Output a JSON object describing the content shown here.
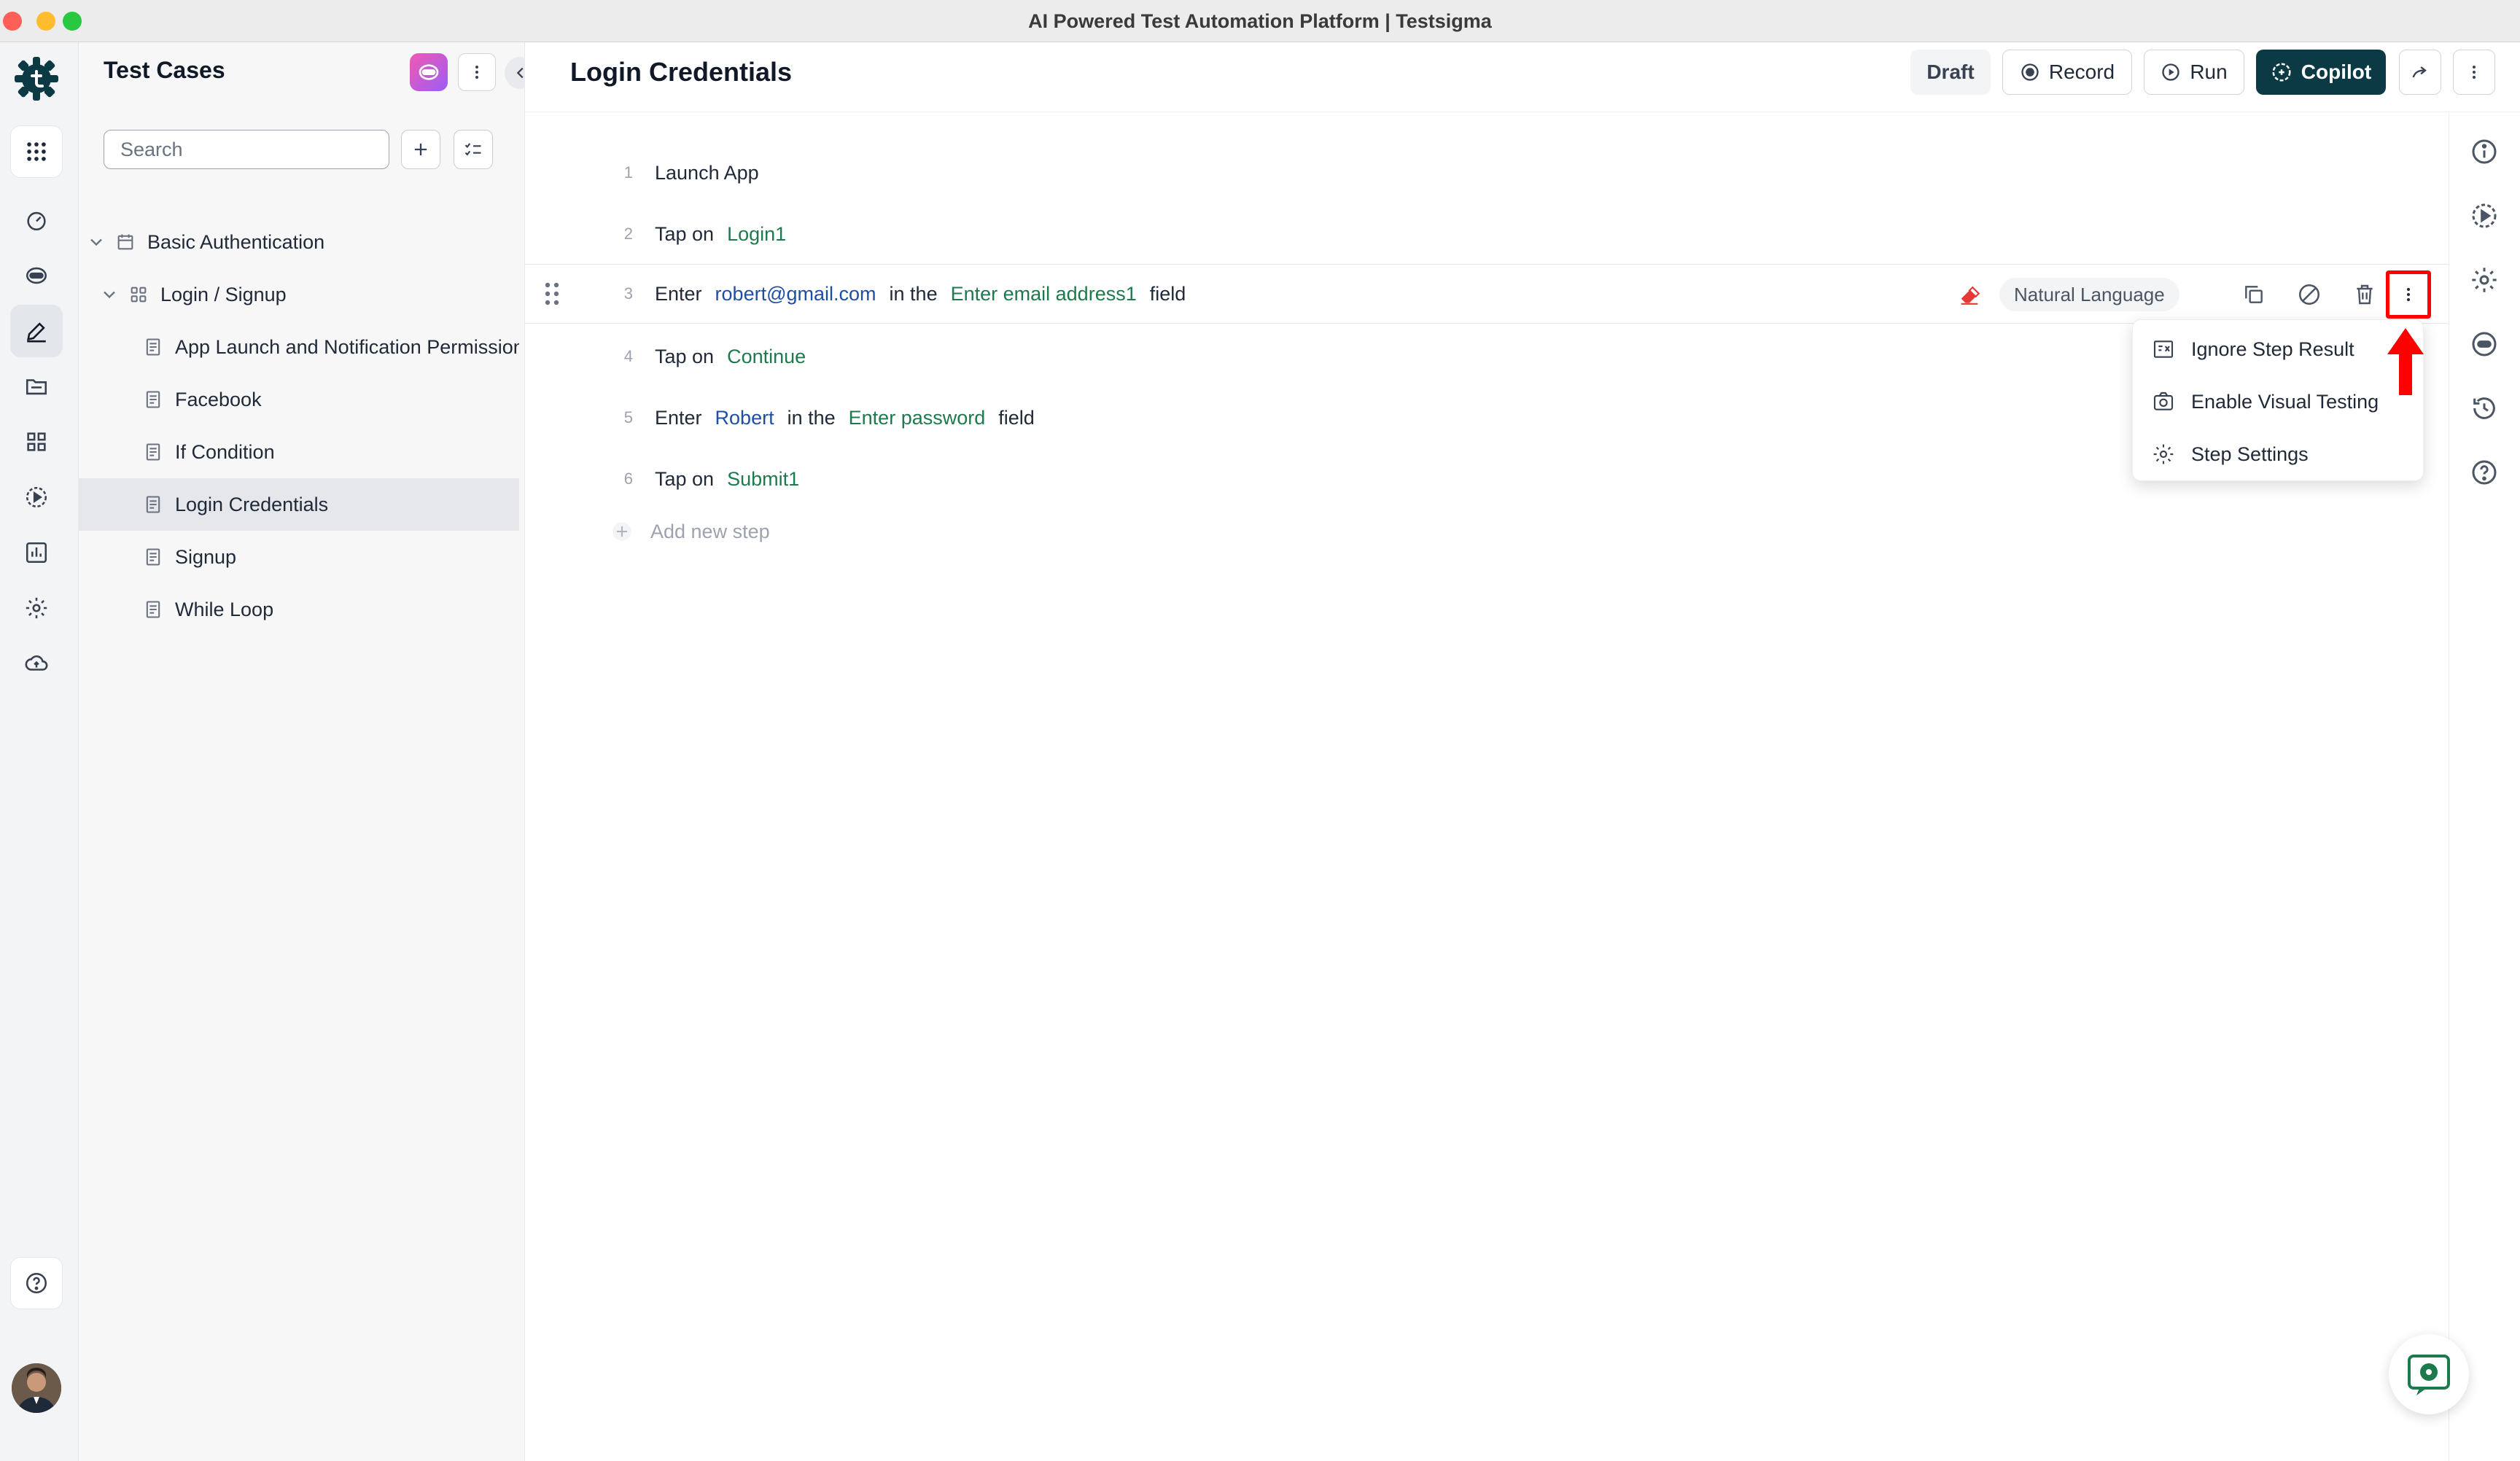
{
  "window": {
    "title": "AI Powered Test Automation Platform | Testsigma"
  },
  "panel": {
    "title": "Test Cases",
    "search_placeholder": "Search",
    "tree": [
      {
        "label": "Basic Authentication",
        "kind": "suite",
        "level": 0
      },
      {
        "label": "Login / Signup",
        "kind": "group",
        "level": 1
      },
      {
        "label": "App Launch and Notification Permission",
        "kind": "case",
        "level": 2
      },
      {
        "label": "Facebook",
        "kind": "case",
        "level": 2
      },
      {
        "label": "If Condition",
        "kind": "case",
        "level": 2
      },
      {
        "label": "Login Credentials",
        "kind": "case",
        "level": 2,
        "selected": true
      },
      {
        "label": "Signup",
        "kind": "case",
        "level": 2
      },
      {
        "label": "While Loop",
        "kind": "case",
        "level": 2
      }
    ]
  },
  "header": {
    "title": "Login Credentials",
    "draft_label": "Draft",
    "record_label": "Record",
    "run_label": "Run",
    "copilot_label": "Copilot"
  },
  "steps": [
    {
      "num": "1",
      "tokens": [
        {
          "t": "plain",
          "v": "Launch App"
        }
      ]
    },
    {
      "num": "2",
      "tokens": [
        {
          "t": "plain",
          "v": "Tap on"
        },
        {
          "t": "el",
          "v": "Login1"
        }
      ]
    },
    {
      "num": "3",
      "tokens": [
        {
          "t": "plain",
          "v": "Enter"
        },
        {
          "t": "val",
          "v": "robert@gmail.com"
        },
        {
          "t": "plain",
          "v": "in the"
        },
        {
          "t": "el",
          "v": "Enter email address1"
        },
        {
          "t": "plain",
          "v": "field"
        }
      ]
    },
    {
      "num": "4",
      "tokens": [
        {
          "t": "plain",
          "v": "Tap on"
        },
        {
          "t": "el",
          "v": "Continue"
        }
      ]
    },
    {
      "num": "5",
      "tokens": [
        {
          "t": "plain",
          "v": "Enter"
        },
        {
          "t": "val",
          "v": "Robert"
        },
        {
          "t": "plain",
          "v": "in the"
        },
        {
          "t": "el",
          "v": "Enter password"
        },
        {
          "t": "plain",
          "v": "field"
        }
      ]
    },
    {
      "num": "6",
      "tokens": [
        {
          "t": "plain",
          "v": "Tap on"
        },
        {
          "t": "el",
          "v": "Submit1"
        }
      ]
    }
  ],
  "step_toolbar": {
    "mode_label": "Natural Language"
  },
  "add_step_label": "Add new step",
  "step_menu": {
    "items": [
      {
        "label": "Ignore Step Result",
        "icon": "ignore-icon"
      },
      {
        "label": "Enable Visual Testing",
        "icon": "camera-icon"
      },
      {
        "label": "Step Settings",
        "icon": "gear-icon"
      }
    ]
  },
  "colors": {
    "element_green": "#1d7a4c",
    "value_blue": "#1f4fa3",
    "copilot_bg": "#0b3a44",
    "highlight_red": "#ff0000"
  }
}
